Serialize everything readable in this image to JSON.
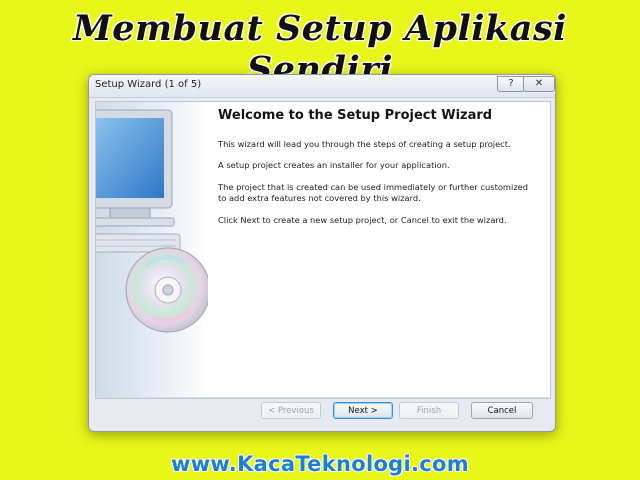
{
  "banner": {
    "title": "Membuat Setup Aplikasi Sendiri"
  },
  "window": {
    "title": "Setup Wizard (1 of 5)",
    "help_glyph": "?",
    "close_glyph": "✕"
  },
  "wizard": {
    "heading": "Welcome to the Setup Project Wizard",
    "paragraphs": [
      "This wizard will lead you through the steps of creating a setup project.",
      "A setup project creates an installer for your application.",
      "The project that is created can be used immediately or further customized to add extra features not covered by this wizard.",
      "Click Next to create a new setup project, or Cancel to exit the wizard."
    ]
  },
  "buttons": {
    "previous": "< Previous",
    "next": "Next >",
    "finish": "Finish",
    "cancel": "Cancel"
  },
  "watermark": {
    "text": "www.KacaTeknologi.com"
  },
  "colors": {
    "background": "#e9f61a",
    "watermark": "#1c7fd6",
    "accent": "#3b8fd6"
  }
}
